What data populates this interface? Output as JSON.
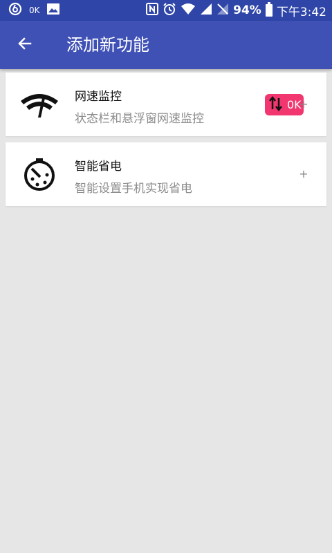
{
  "status_bar": {
    "left_text": "0K",
    "battery": "94%",
    "time": "下午3:42",
    "icons": [
      "netease-icon",
      "image-icon",
      "nfc-icon",
      "alarm-icon",
      "wifi-icon",
      "signal-icon",
      "no-sim-icon",
      "battery-icon"
    ]
  },
  "toolbar": {
    "title": "添加新功能",
    "back_icon": "arrow-left-icon"
  },
  "features": [
    {
      "title": "网速监控",
      "subtitle": "状态栏和悬浮窗网速监控",
      "icon": "wifi-speed-icon",
      "badge_text": "0K",
      "add_label": "+"
    },
    {
      "title": "智能省电",
      "subtitle": "智能设置手机实现省电",
      "icon": "power-timer-icon",
      "add_label": "+"
    }
  ],
  "colors": {
    "status_bar": "#2f46a8",
    "toolbar": "#3f51b5",
    "background": "#e6e6e6",
    "badge": "#f2366f"
  }
}
